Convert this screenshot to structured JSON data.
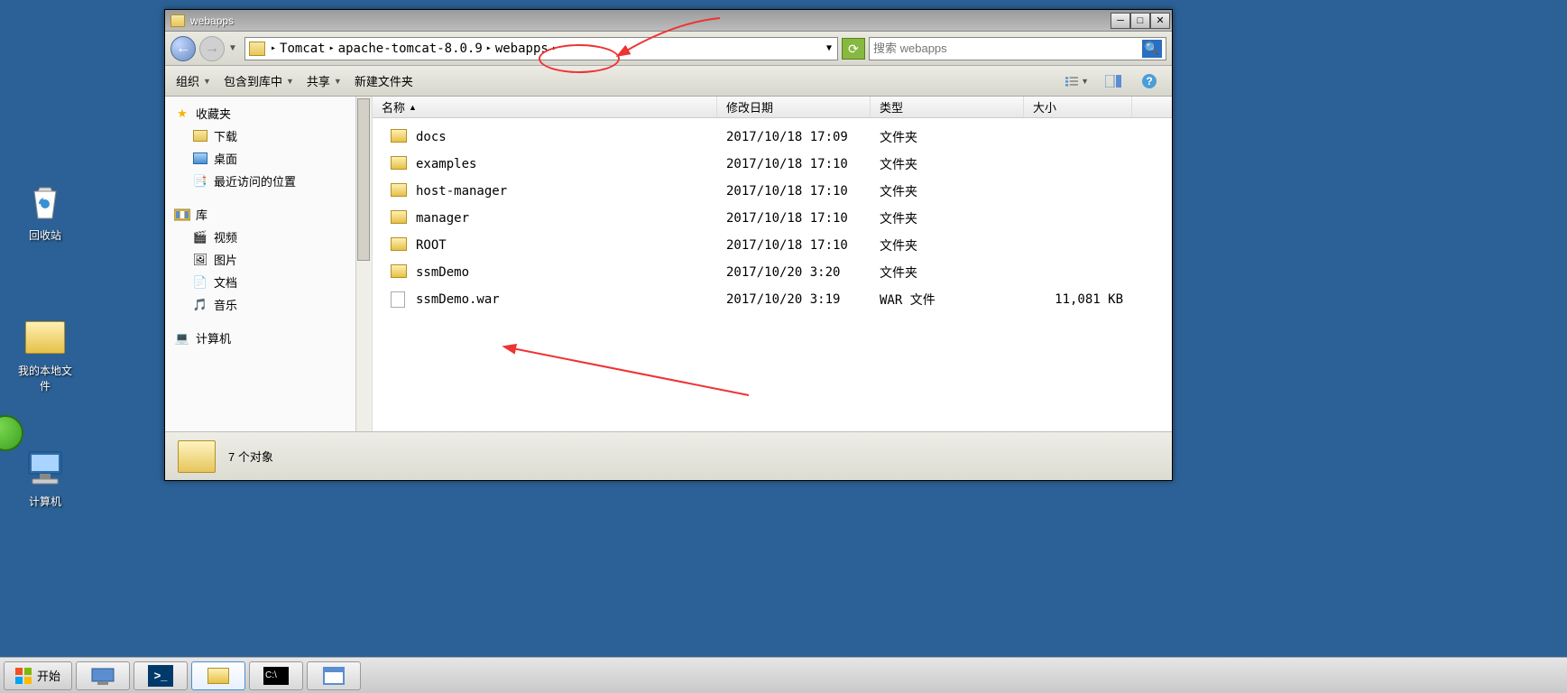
{
  "desktop": {
    "recycle_bin": "回收站",
    "my_local_files": "我的本地文\n件",
    "computer": "计算机"
  },
  "window": {
    "title": "webapps",
    "breadcrumb": {
      "segments": [
        "Tomcat",
        "apache-tomcat-8.0.9",
        "webapps"
      ]
    },
    "search_placeholder": "搜索 webapps",
    "toolbar": {
      "organize": "组织",
      "include_in_library": "包含到库中",
      "share": "共享",
      "new_folder": "新建文件夹"
    },
    "sidebar": {
      "favorites": "收藏夹",
      "downloads": "下载",
      "desktop": "桌面",
      "recent": "最近访问的位置",
      "libraries": "库",
      "videos": "视频",
      "pictures": "图片",
      "documents": "文档",
      "music": "音乐",
      "computer": "计算机"
    },
    "columns": {
      "name": "名称",
      "modified": "修改日期",
      "type": "类型",
      "size": "大小"
    },
    "files": [
      {
        "name": "docs",
        "date": "2017/10/18 17:09",
        "type": "文件夹",
        "size": "",
        "kind": "folder"
      },
      {
        "name": "examples",
        "date": "2017/10/18 17:10",
        "type": "文件夹",
        "size": "",
        "kind": "folder"
      },
      {
        "name": "host-manager",
        "date": "2017/10/18 17:10",
        "type": "文件夹",
        "size": "",
        "kind": "folder"
      },
      {
        "name": "manager",
        "date": "2017/10/18 17:10",
        "type": "文件夹",
        "size": "",
        "kind": "folder"
      },
      {
        "name": "ROOT",
        "date": "2017/10/18 17:10",
        "type": "文件夹",
        "size": "",
        "kind": "folder"
      },
      {
        "name": "ssmDemo",
        "date": "2017/10/20 3:20",
        "type": "文件夹",
        "size": "",
        "kind": "folder"
      },
      {
        "name": "ssmDemo.war",
        "date": "2017/10/20 3:19",
        "type": "WAR 文件",
        "size": "11,081 KB",
        "kind": "file"
      }
    ],
    "status": "7 个对象"
  },
  "taskbar": {
    "start": "开始"
  }
}
